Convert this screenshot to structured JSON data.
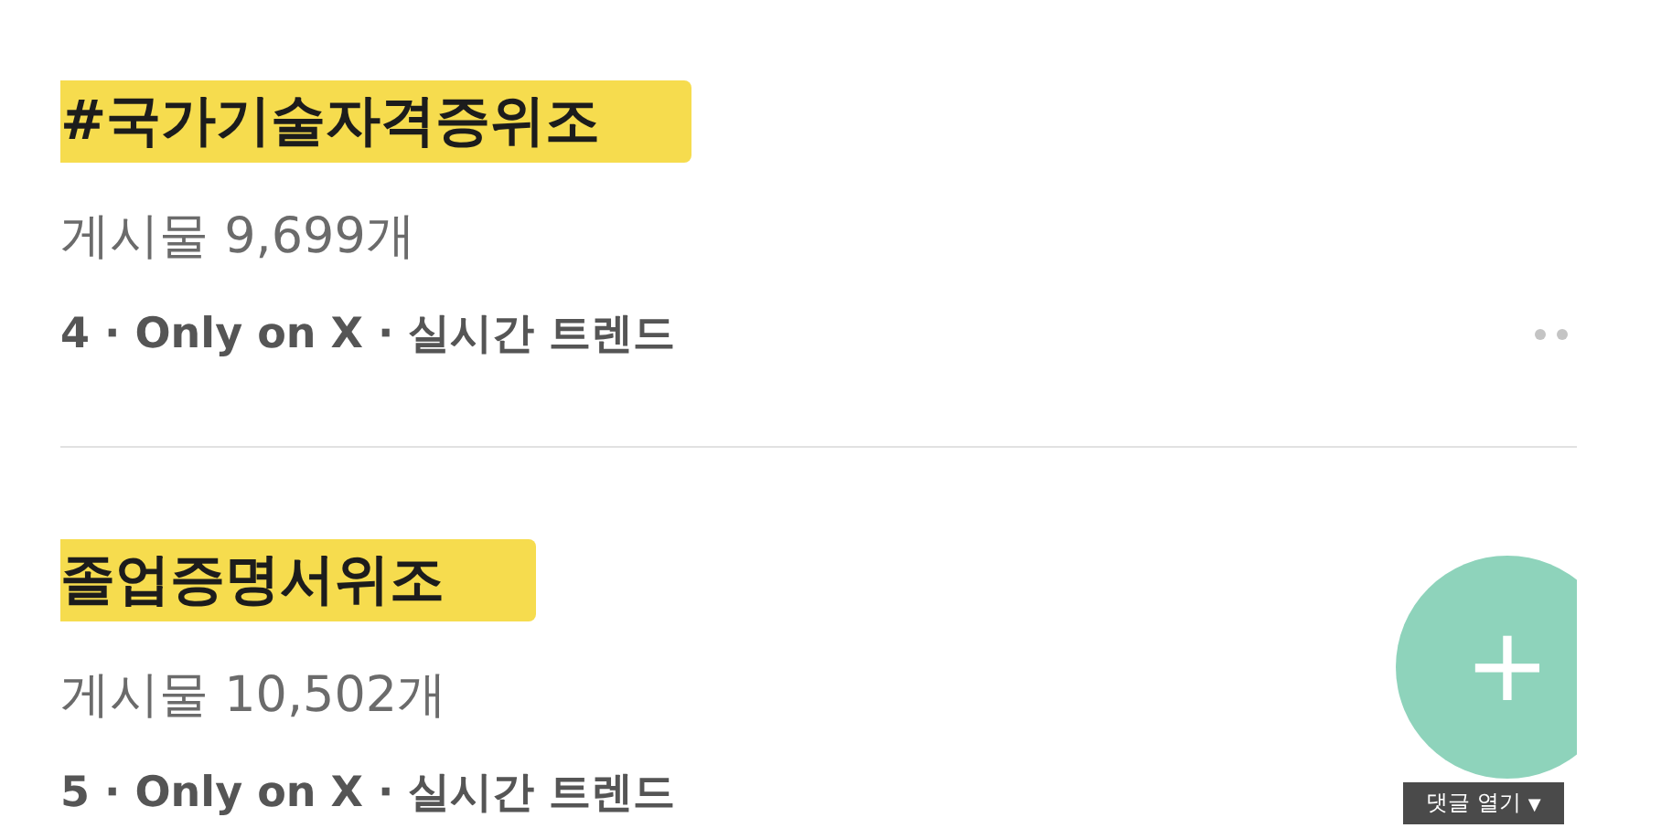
{
  "trends": [
    {
      "title": "#국가기술자격증위조",
      "highlighted": true,
      "count": "게시물 9,699개",
      "meta": "4 · Only on X · 실시간 트렌드",
      "menu": true
    },
    {
      "title": "졸업증명서위조",
      "highlighted": true,
      "count": "게시물 10,502개",
      "meta": "5 · Only on X · 실시간 트렌드",
      "menu": false
    }
  ],
  "fab": {
    "label": "+"
  },
  "comment_toggle": {
    "label": "댓글 열기",
    "caret": "▼"
  }
}
